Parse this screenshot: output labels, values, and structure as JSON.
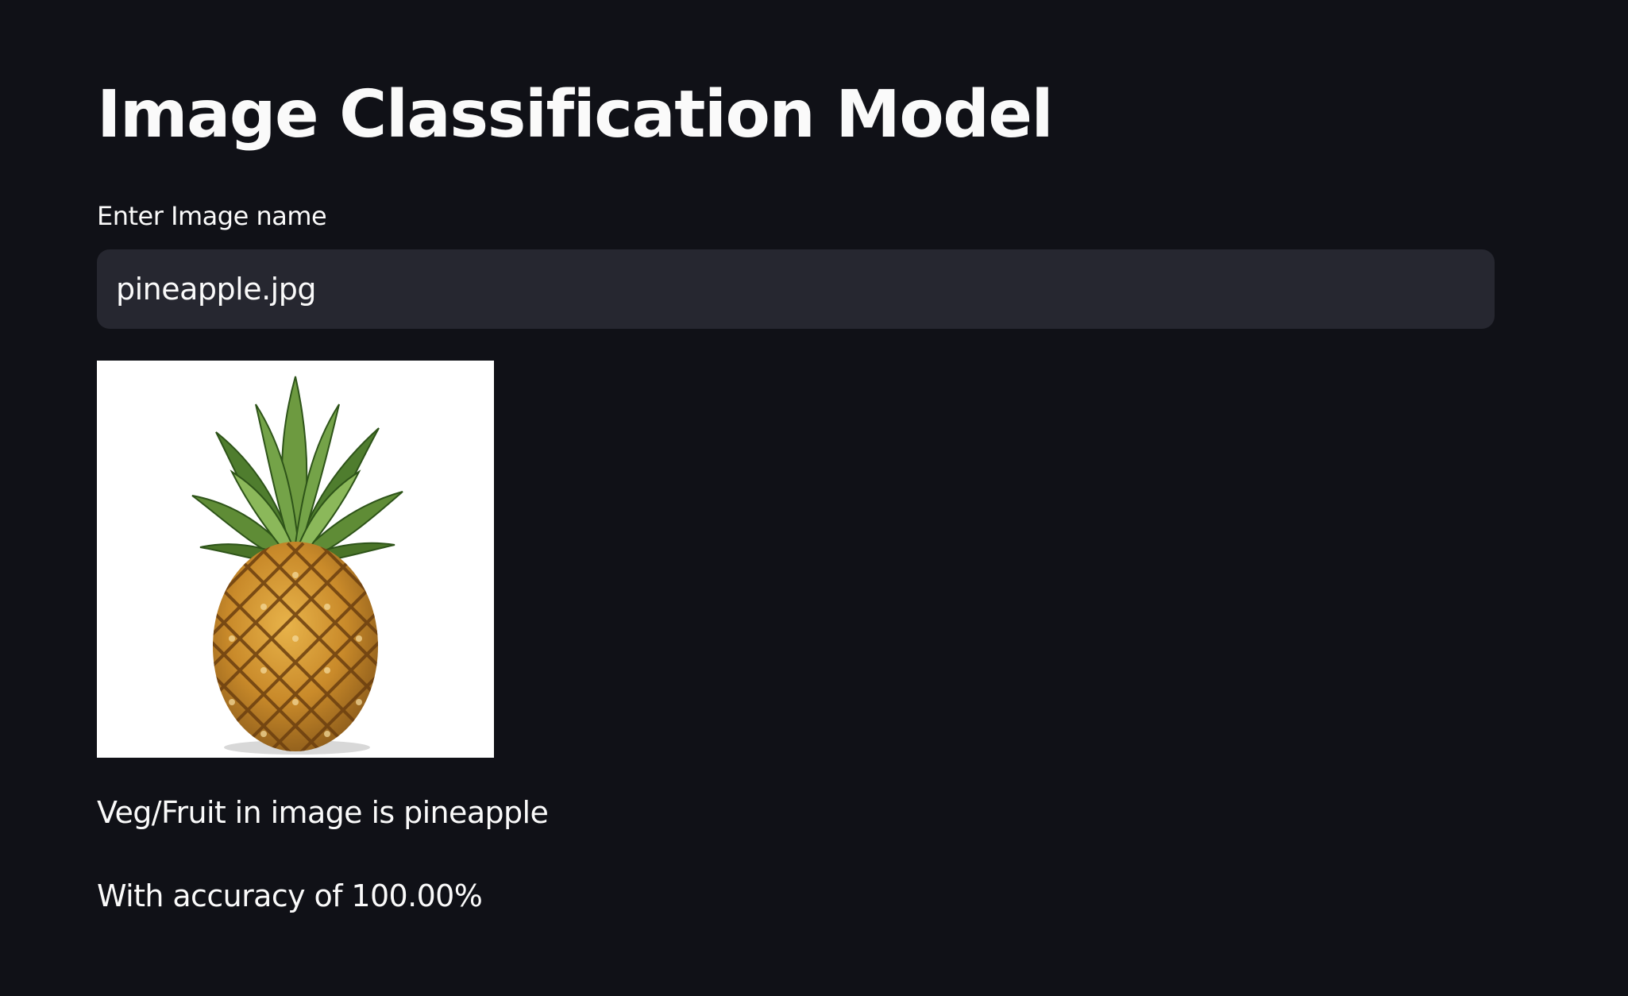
{
  "page": {
    "title": "Image Classification Model"
  },
  "input": {
    "label": "Enter Image name",
    "value": "pineapple.jpg"
  },
  "image": {
    "subject": "pineapple",
    "icon": "pineapple-image"
  },
  "results": {
    "prediction": "Veg/Fruit in image is pineapple",
    "accuracy": "With accuracy of 100.00%"
  },
  "colors": {
    "background": "#101117",
    "input_background": "#262730",
    "text": "#fafafa"
  }
}
